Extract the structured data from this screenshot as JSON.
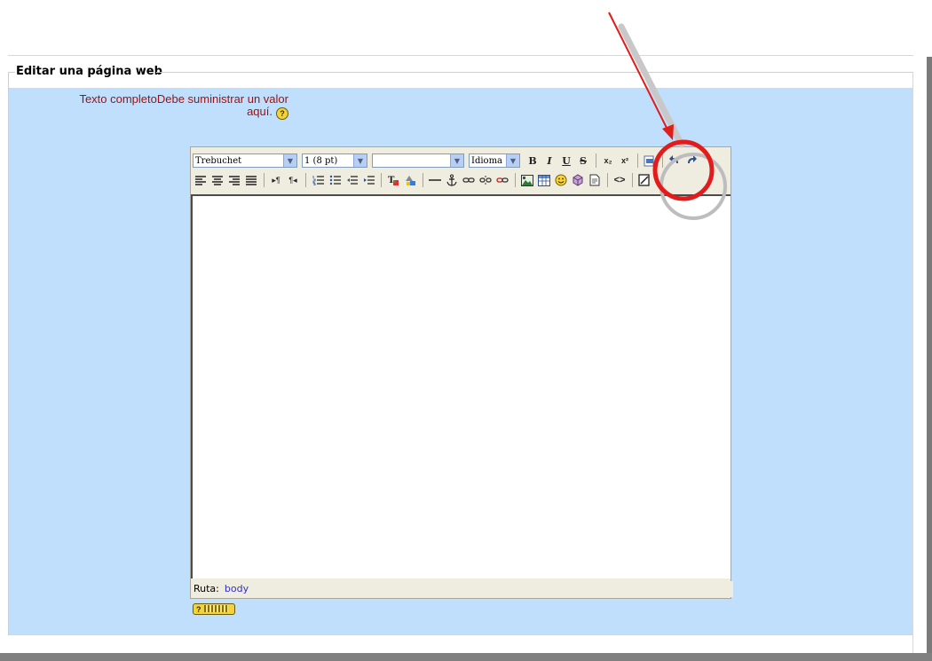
{
  "fieldset": {
    "legend": "Editar una página web"
  },
  "field": {
    "label_line1": "Texto completoDebe suministrar un valor",
    "label_line2": "aquí.",
    "help_glyph": "?"
  },
  "toolbar": {
    "font_family": "Trebuchet",
    "font_size": "1 (8 pt)",
    "heading": "",
    "language": "Idioma",
    "bold": "B",
    "italic": "I",
    "underline": "U",
    "strike": "S",
    "subscript": "x₂",
    "superscript": "x²",
    "html_source": "<>"
  },
  "statusbar": {
    "label": "Ruta:",
    "path": "body"
  },
  "keyboard_help": {
    "glyph": "?"
  },
  "icons": [
    "align-left-icon",
    "align-center-icon",
    "align-right-icon",
    "justify-icon",
    "ltr-icon",
    "rtl-icon",
    "ordered-list-icon",
    "unordered-list-icon",
    "outdent-icon",
    "indent-icon",
    "text-color-icon",
    "background-color-icon",
    "horizontal-rule-icon",
    "anchor-icon",
    "link-icon",
    "unlink-icon",
    "nolink-icon",
    "image-icon",
    "table-icon",
    "smiley-icon",
    "special-char-icon",
    "search-replace-icon",
    "html-source-icon",
    "fullscreen-icon",
    "paste-word-icon",
    "undo-icon",
    "redo-icon"
  ],
  "colors": {
    "form_background": "#bfdffc",
    "label": "#9c1010",
    "annotation": "#ff0000",
    "help": "#f2d33a"
  }
}
